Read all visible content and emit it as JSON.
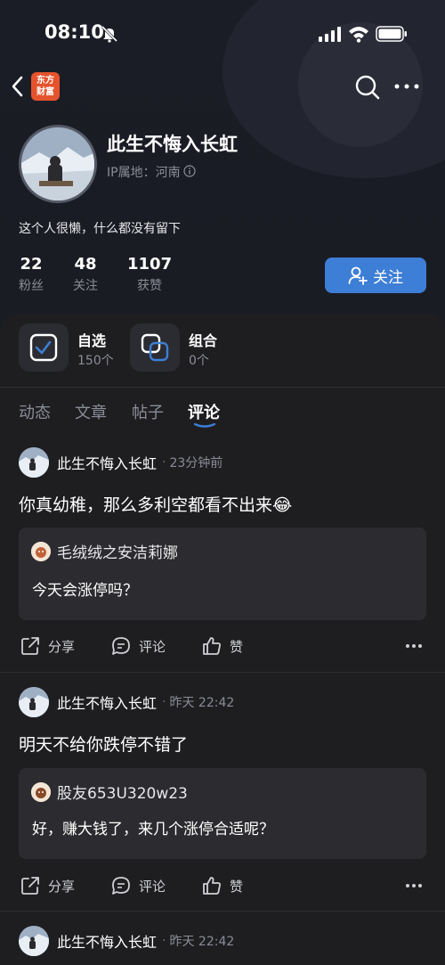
{
  "status_bar": {
    "time": "08:10"
  },
  "logo": {
    "line1": "东方",
    "line2": "财富"
  },
  "profile": {
    "name": "此生不悔入长虹",
    "ip_location": "IP属地：河南",
    "bio": "这个人很懒，什么都没有留下",
    "stats": [
      {
        "value": "22",
        "label": "粉丝"
      },
      {
        "value": "48",
        "label": "关注"
      },
      {
        "value": "1107",
        "label": "获赞"
      }
    ],
    "follow_label": "关注"
  },
  "quick_cards": [
    {
      "title": "自选",
      "subtitle": "150个"
    },
    {
      "title": "组合",
      "subtitle": "0个"
    }
  ],
  "tabs": [
    "动态",
    "文章",
    "帖子",
    "评论"
  ],
  "active_tab": "评论",
  "actions": {
    "share": "分享",
    "comment": "评论",
    "like": "赞"
  },
  "posts": [
    {
      "user": "此生不悔入长虹",
      "time": "23分钟前",
      "text": "你真幼稚，那么多利空都看不出来😂",
      "quote_user": "毛绒绒之安洁莉娜",
      "quote_text": "今天会涨停吗？"
    },
    {
      "user": "此生不悔入长虹",
      "time": "昨天 22:42",
      "text": "明天不给你跌停不错了",
      "quote_user": "股友653U320w23",
      "quote_text": "好，赚大钱了，来几个涨停合适呢？"
    },
    {
      "user": "此生不悔入长虹",
      "time": "昨天 22:42"
    }
  ],
  "colors": {
    "accent": "#3d7ed6",
    "background": "#1e1e21",
    "logo": "#e5532d"
  }
}
